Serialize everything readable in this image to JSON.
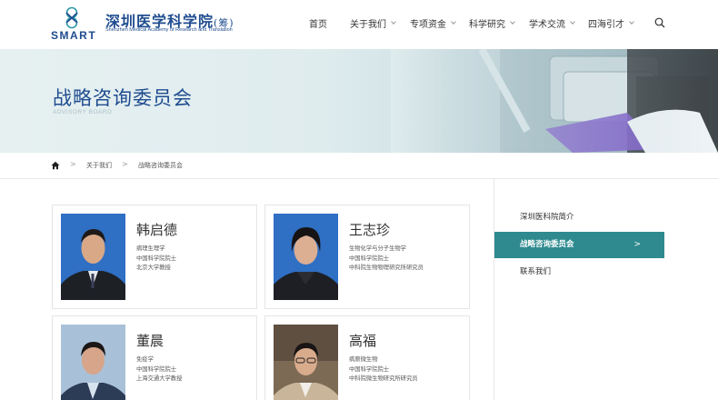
{
  "header": {
    "logo_smart": "SMART",
    "logo_cn": "深圳医学科学院",
    "logo_paren": "(筹)",
    "logo_en": "Shenzhen Medical Academy of Research and Translation",
    "nav": [
      {
        "label": "首页"
      },
      {
        "label": "关于我们"
      },
      {
        "label": "专项资金"
      },
      {
        "label": "科学研究"
      },
      {
        "label": "学术交流"
      },
      {
        "label": "四海引才"
      }
    ]
  },
  "banner": {
    "title": "战略咨询委员会",
    "subtitle": "ADVISORY BOARD"
  },
  "breadcrumb": {
    "items": [
      "关于我们",
      "战略咨询委员会"
    ],
    "separator": ">"
  },
  "sidebar": {
    "items": [
      {
        "label": "深圳医科院简介"
      },
      {
        "label": "战略咨询委员会"
      },
      {
        "label": "联系我们"
      }
    ],
    "active_arrow": ">"
  },
  "members": [
    {
      "name": "韩启德",
      "lines": [
        "病理生理学",
        "中国科学院院士",
        "北京大学教授"
      ]
    },
    {
      "name": "王志珍",
      "lines": [
        "生物化学与分子生物学",
        "中国科学院院士",
        "中科院生物物理研究所研究员"
      ]
    },
    {
      "name": "董晨",
      "lines": [
        "免疫学",
        "中国科学院院士",
        "上海交通大学教授"
      ]
    },
    {
      "name": "高福",
      "lines": [
        "病原微生物",
        "中国科学院院士",
        "中科院微生物研究所研究员"
      ]
    }
  ],
  "colors": {
    "brand_blue": "#1f4c8f",
    "active_teal": "#2e8a8f"
  },
  "icons": {
    "search": "search-icon",
    "home": "home-icon",
    "chevron": "chevron-down-icon"
  }
}
